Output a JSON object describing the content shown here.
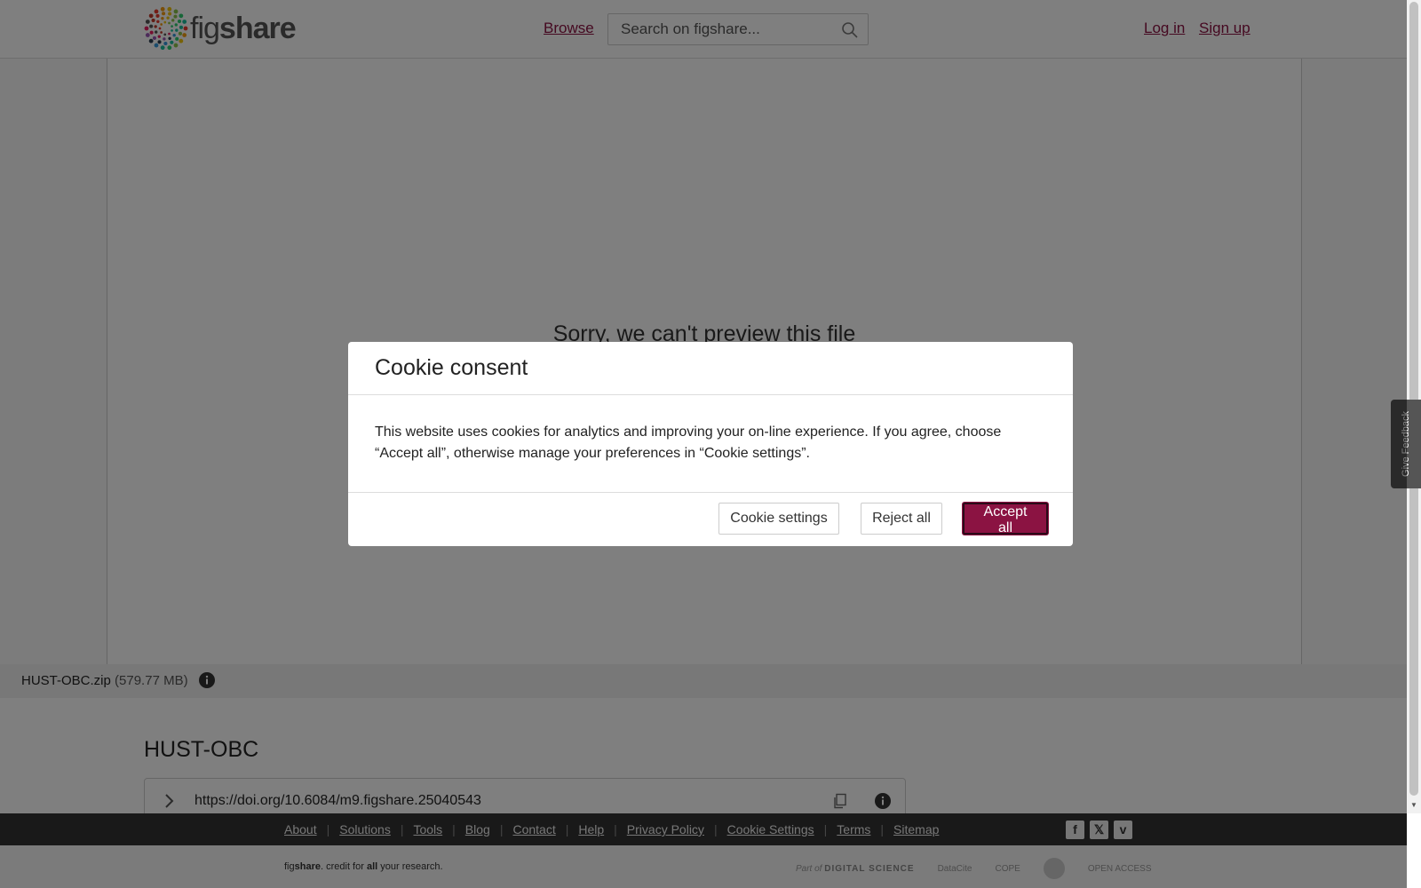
{
  "header": {
    "logo_fig": "fig",
    "logo_share": "share",
    "browse_label": "Browse",
    "search_placeholder": "Search on figshare...",
    "login_label": "Log in",
    "signup_label": "Sign up"
  },
  "preview": {
    "message": "Sorry, we can't preview this file"
  },
  "file": {
    "name": "HUST-OBC.zip",
    "size": "(579.77 MB)"
  },
  "item": {
    "title": "HUST-OBC",
    "doi": "https://doi.org/10.6084/m9.figshare.25040543"
  },
  "footer": {
    "links": [
      "About",
      "Solutions",
      "Tools",
      "Blog",
      "Contact",
      "Help",
      "Privacy Policy",
      "Cookie Settings",
      "Terms",
      "Sitemap"
    ],
    "social": [
      "f",
      "𝕏",
      "v"
    ],
    "tagline_fig": "fig",
    "tagline_share": "share",
    "tagline_mid": ". credit for ",
    "tagline_all": "all",
    "tagline_end": " your research.",
    "partner_partof": "Part of",
    "partner_ds": "DIGITAL SCIENCE",
    "partner_datacite": "DataCite",
    "partner_cope": "COPE",
    "partner_oa": "OPEN ACCESS"
  },
  "feedback": {
    "label": "Give Feedback"
  },
  "modal": {
    "title": "Cookie consent",
    "body": "This website uses cookies for analytics and improving your on-line experience. If you agree, choose “Accept all”, otherwise manage your preferences in “Cookie settings”.",
    "settings_label": "Cookie settings",
    "reject_label": "Reject all",
    "accept_label": "Accept all"
  },
  "colors": {
    "brand": "#8b1342",
    "footer_dark": "#333333"
  }
}
